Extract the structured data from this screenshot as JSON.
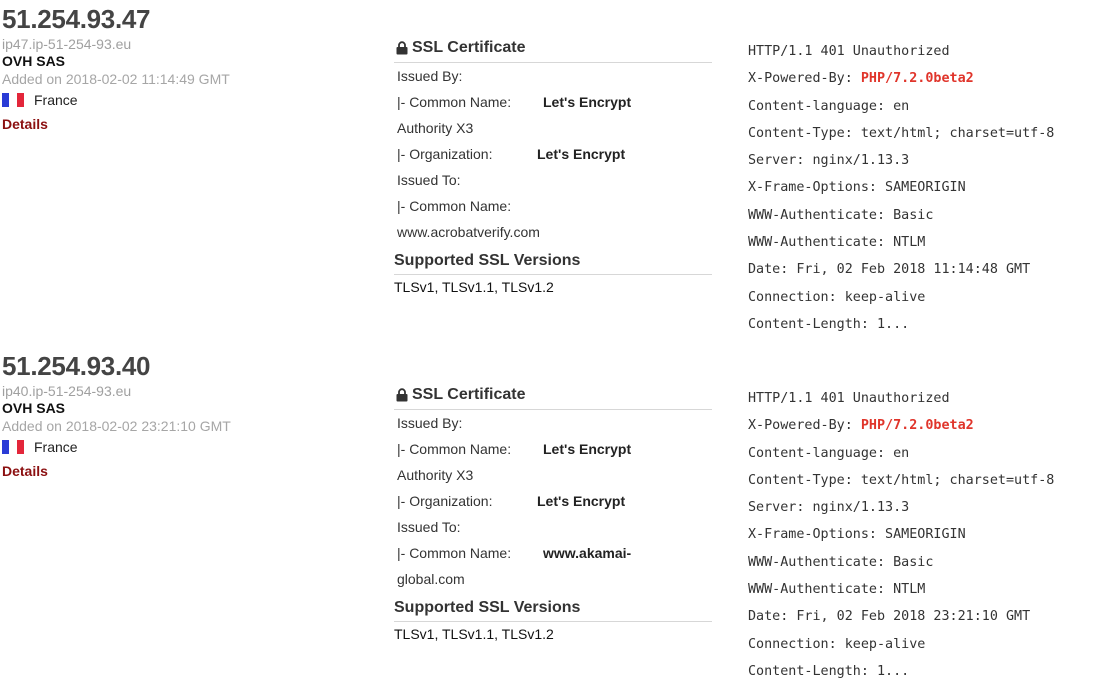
{
  "results": [
    {
      "ip": "51.254.93.47",
      "hostname": "ip47.ip-51-254-93.eu",
      "org": "OVH SAS",
      "added": "Added on 2018-02-02 11:14:49 GMT",
      "country": "France",
      "flag_icon": "france-flag-icon",
      "details_label": "Details",
      "ssl": {
        "title": "SSL Certificate",
        "issued_by_label": "Issued By:",
        "issuer_cn_label": "|- Common Name:",
        "issuer_cn_value": "Let's Encrypt",
        "issuer_cn_value_cont": "Authority X3",
        "issuer_org_label": "|- Organization:",
        "issuer_org_value": "Let's Encrypt",
        "issued_to_label": "Issued To:",
        "subject_cn_label": "|- Common Name:",
        "subject_cn_value": "",
        "subject_cn_value_cont": "www.acrobatverify.com",
        "supported_title": "Supported SSL Versions",
        "versions": "TLSv1, TLSv1.1, TLSv1.2"
      },
      "banner": {
        "status": "HTTP/1.1 401 Unauthorized",
        "powered_key": "X-Powered-By: ",
        "powered_value": "PHP/7.2.0beta2",
        "lines": [
          "Content-language: en",
          "Content-Type: text/html; charset=utf-8",
          "Server: nginx/1.13.3",
          "X-Frame-Options: SAMEORIGIN",
          "WWW-Authenticate: Basic",
          "WWW-Authenticate: NTLM",
          "Date: Fri, 02 Feb 2018 11:14:48 GMT",
          "Connection: keep-alive",
          "Content-Length: 1..."
        ]
      }
    },
    {
      "ip": "51.254.93.40",
      "hostname": "ip40.ip-51-254-93.eu",
      "org": "OVH SAS",
      "added": "Added on 2018-02-02 23:21:10 GMT",
      "country": "France",
      "flag_icon": "france-flag-icon",
      "details_label": "Details",
      "ssl": {
        "title": "SSL Certificate",
        "issued_by_label": "Issued By:",
        "issuer_cn_label": "|- Common Name:",
        "issuer_cn_value": "Let's Encrypt",
        "issuer_cn_value_cont": "Authority X3",
        "issuer_org_label": "|- Organization:",
        "issuer_org_value": "Let's Encrypt",
        "issued_to_label": "Issued To:",
        "subject_cn_label": "|- Common Name:",
        "subject_cn_value": "www.akamai-",
        "subject_cn_value_cont": "global.com",
        "supported_title": "Supported SSL Versions",
        "versions": "TLSv1, TLSv1.1, TLSv1.2"
      },
      "banner": {
        "status": "HTTP/1.1 401 Unauthorized",
        "powered_key": "X-Powered-By: ",
        "powered_value": "PHP/7.2.0beta2",
        "lines": [
          "Content-language: en",
          "Content-Type: text/html; charset=utf-8",
          "Server: nginx/1.13.3",
          "X-Frame-Options: SAMEORIGIN",
          "WWW-Authenticate: Basic",
          "WWW-Authenticate: NTLM",
          "Date: Fri, 02 Feb 2018 23:21:10 GMT",
          "Connection: keep-alive",
          "Content-Length: 1..."
        ]
      }
    }
  ],
  "colors": {
    "details_link": "#8b0f10",
    "php_highlight": "#e0352b",
    "muted_text": "#a6a6a6"
  }
}
